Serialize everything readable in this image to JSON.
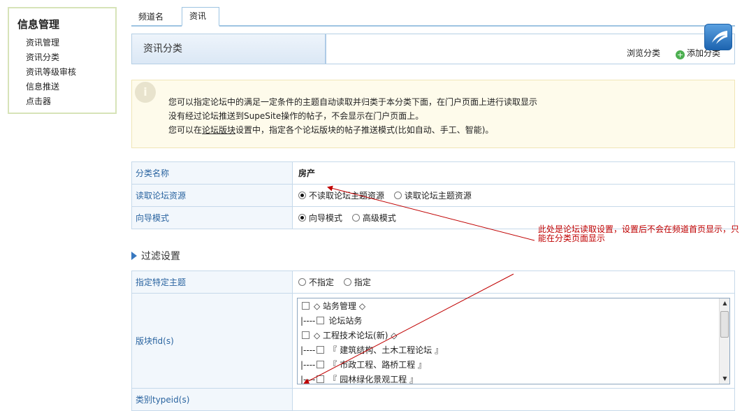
{
  "sidebar": {
    "title": "信息管理",
    "items": [
      {
        "label": "资讯管理"
      },
      {
        "label": "资讯分类"
      },
      {
        "label": "资讯等级审核"
      },
      {
        "label": "信息推送"
      },
      {
        "label": "点击器"
      }
    ]
  },
  "tabs": [
    {
      "label": "频道名"
    },
    {
      "label": "资讯"
    }
  ],
  "titlebar": {
    "title": "资讯分类",
    "browse": "浏览分类",
    "add": "添加分类"
  },
  "notice": {
    "line1": "您可以指定论坛中的满足一定条件的主题自动读取并归类于本分类下面，在门户页面上进行读取显示",
    "line2": "没有经过论坛推送到SupeSite操作的帖子，不会显示在门户页面上。",
    "line3_pre": "您可以在",
    "line3_link": "论坛版块",
    "line3_post": "设置中，指定各个论坛版块的帖子推送模式(比如自动、手工、智能)。"
  },
  "form1": {
    "category_name_label": "分类名称",
    "category_name_value": "房产",
    "read_forum_label": "读取论坛资源",
    "read_forum_opt1": "不读取论坛主题资源",
    "read_forum_opt2": "读取论坛主题资源",
    "guide_label": "向导模式",
    "guide_opt1": "向导模式",
    "guide_opt2": "高级模式"
  },
  "filter": {
    "section_title": "过滤设置",
    "topic_label": "指定特定主题",
    "topic_opt1": "不指定",
    "topic_opt2": "指定",
    "fid_label": "版块fid(s)",
    "fid_items": [
      {
        "prefix": "",
        "text": "◇ 站务管理 ◇"
      },
      {
        "prefix": "|----",
        "text": "论坛站务"
      },
      {
        "prefix": "",
        "text": "◇ 工程技术论坛(新) ◇"
      },
      {
        "prefix": "|----",
        "text": "『 建筑结构、土木工程论坛 』"
      },
      {
        "prefix": "|----",
        "text": "『 市政工程、路桥工程 』"
      },
      {
        "prefix": "|----",
        "text": "『 园林绿化景观工程 』"
      }
    ],
    "typeid_label": "类别typeid(s)"
  },
  "annotation": "此处是论坛读取设置，设置后不会在频道首页显示，只能在分类页面显示",
  "colors": {
    "accent": "#2a64a0",
    "annotation": "#c00000",
    "notice_bg": "#fefbeb"
  }
}
